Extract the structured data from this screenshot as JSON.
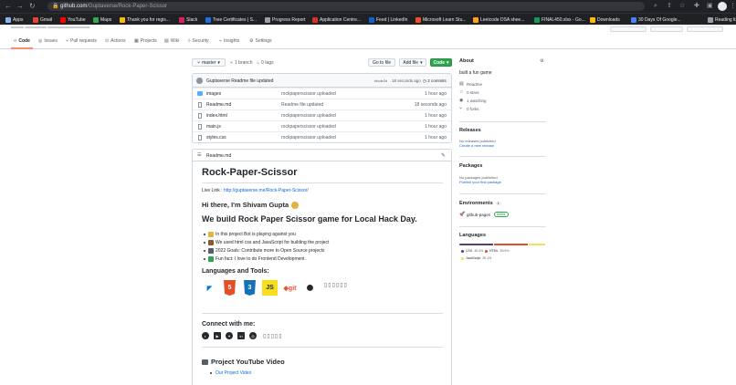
{
  "browser": {
    "url_host": "github.com",
    "url_path": "/Guptaverse/Rock-Paper-Scissor"
  },
  "bookmarks": [
    {
      "label": "Apps",
      "color": "#8ab4f8"
    },
    {
      "label": "Gmail",
      "color": "#ea4335"
    },
    {
      "label": "YouTube",
      "color": "#ff0000"
    },
    {
      "label": "Maps",
      "color": "#34a853"
    },
    {
      "label": "Thank you for regis...",
      "color": "#fbbc04"
    },
    {
      "label": "Slack",
      "color": "#e01e5a"
    },
    {
      "label": "Tree Certificates | S...",
      "color": "#1a73e8"
    },
    {
      "label": "Progress Report",
      "color": "#9aa0a6"
    },
    {
      "label": "Application Centre...",
      "color": "#d93025"
    },
    {
      "label": "Feed | LinkedIn",
      "color": "#0a66c2"
    },
    {
      "label": "Microsoft Learn Stu...",
      "color": "#f25022"
    },
    {
      "label": "Leetcode DSA shee...",
      "color": "#ffa116"
    },
    {
      "label": "FINAL450.xlsx - Go...",
      "color": "#0f9d58"
    },
    {
      "label": "Downloads",
      "color": "#fbbc04"
    },
    {
      "label": "30 Days Of Google...",
      "color": "#4285f4"
    },
    {
      "label": "Reading list",
      "color": "#9aa0a6"
    }
  ],
  "repo_header": {
    "tabs": [
      "Code",
      "Issues",
      "Pull requests",
      "Actions",
      "Projects",
      "Wiki",
      "Security",
      "Insights",
      "Settings"
    ]
  },
  "toolbar": {
    "branch": "master",
    "branches": "1 branch",
    "tags": "0 tags",
    "go_to_file": "Go to file",
    "add_file": "Add file",
    "code": "Code"
  },
  "commit": {
    "message": "Guptaverse Readme file updated",
    "sha": "bfcde2d",
    "time": "18 seconds ago",
    "commits": "2 commits"
  },
  "files": [
    {
      "name": "images",
      "type": "dir",
      "message": "rockpaperscissor uploaded",
      "age": "1 hour ago"
    },
    {
      "name": "Readme.md",
      "type": "file",
      "message": "Readme file updated",
      "age": "18 seconds ago"
    },
    {
      "name": "index.html",
      "type": "file",
      "message": "rockpaperscissor uploaded",
      "age": "1 hour ago"
    },
    {
      "name": "main.js",
      "type": "file",
      "message": "rockpaperscissor uploaded",
      "age": "1 hour ago"
    },
    {
      "name": "styles.css",
      "type": "file",
      "message": "rockpaperscissor uploaded",
      "age": "1 hour ago"
    }
  ],
  "readme": {
    "filename": "Readme.md",
    "title": "Rock-Paper-Scissor",
    "live_label": "Live Link :",
    "live_url": "http://guptaverse.me/Rock-Paper-Scissor/",
    "greeting": "Hi there, I'm Shivam Gupta",
    "subtitle": "We build Rock Paper Scissor game for Local Hack Day.",
    "bullets": [
      {
        "text": "In this project Bot is playing against you",
        "color": "#e3b341"
      },
      {
        "text": "We used html css and JavaScript for building the project",
        "color": "#8b5a2b"
      },
      {
        "text": "2022 Goals: Contribute more to Open Source projects",
        "color": "#57606a"
      },
      {
        "text": "Fun fact: I love to do Frontend Development.",
        "color": "#2da44e"
      }
    ],
    "tools_heading": "Languages and Tools:",
    "tools": [
      {
        "name": "vscode",
        "glyph": "◤",
        "color": "#0078d4",
        "bg": "#ffffff"
      },
      {
        "name": "html5",
        "glyph": "5",
        "color": "#ffffff",
        "bg": "#e34f26"
      },
      {
        "name": "css3",
        "glyph": "3",
        "color": "#ffffff",
        "bg": "#1572b6"
      },
      {
        "name": "javascript",
        "glyph": "JS",
        "color": "#24292f",
        "bg": "#f7df1e"
      },
      {
        "name": "git",
        "glyph": "◆git",
        "color": "#f05032",
        "bg": "#ffffff"
      },
      {
        "name": "github",
        "glyph": "●",
        "color": "#24292f",
        "bg": "#ffffff"
      }
    ],
    "tools_boxes": "▯▯▯▯▯▯",
    "connect_heading": "Connect with me:",
    "social": [
      "hashnode",
      "youtube",
      "twitter",
      "linkedin",
      "instagram"
    ],
    "social_boxes": "▯▯▯▯▯",
    "video_heading": "Project YouTube Video",
    "video_link": "Our Project Video"
  },
  "sidebar": {
    "about_heading": "About",
    "description": "built a fun game",
    "readme": "Readme",
    "stars": "0 stars",
    "watching": "1 watching",
    "forks": "0 forks",
    "releases_heading": "Releases",
    "releases_none": "No releases published",
    "releases_link": "Create a new release",
    "packages_heading": "Packages",
    "packages_none": "No packages published",
    "packages_link": "Publish your first package",
    "environments_heading": "Environments",
    "environments_count": "1",
    "environment_name": "github-pages",
    "environment_status": "Active",
    "languages_heading": "Languages",
    "languages": [
      {
        "name": "CSS",
        "percent": 40.0,
        "label": "40.0%",
        "color": "#563d7c"
      },
      {
        "name": "HTML",
        "percent": 39.9,
        "label": "39.9%",
        "color": "#e34c26"
      },
      {
        "name": "JavaScript",
        "percent": 20.1,
        "label": "20.1%",
        "color": "#f1e05a"
      }
    ]
  }
}
